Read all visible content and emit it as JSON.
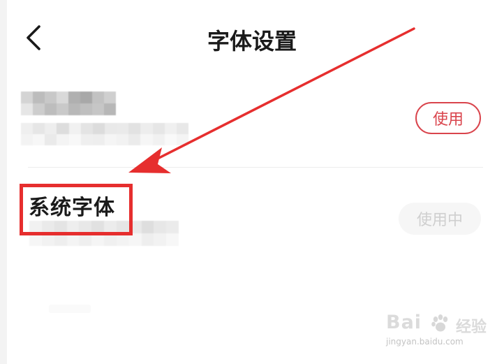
{
  "header": {
    "back_icon": "chevron-left-icon",
    "title": "字体设置"
  },
  "fonts": [
    {
      "name": "",
      "description": "",
      "obscured": true,
      "button_label": "使用",
      "button_state": "available"
    },
    {
      "name": "系统字体",
      "description": "",
      "description_obscured": true,
      "button_label": "使用中",
      "button_state": "in-use"
    }
  ],
  "annotation": {
    "highlight_color": "#e62e2e",
    "arrow_color": "#e62e2e"
  },
  "watermark": {
    "brand": "Bai",
    "suffix": "经验",
    "url": "jingyan.baidu.com"
  },
  "colors": {
    "accent": "#d9444c",
    "title": "#1a1a1a",
    "disabled_text": "#cfcfcf",
    "disabled_bg": "#f6f6f6"
  }
}
